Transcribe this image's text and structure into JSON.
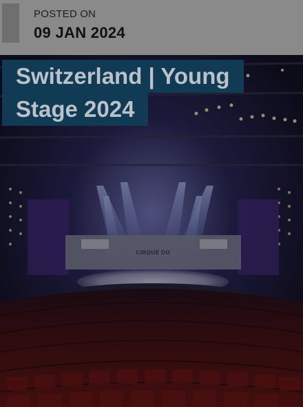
{
  "post": {
    "posted_label": "POSTED ON",
    "posted_date": "09 JAN 2024",
    "title_line_1": "Switzerland | Young",
    "title_line_2": "Stage 2024"
  },
  "hero": {
    "screen_text": "CIRQUE DU"
  },
  "colors": {
    "overlay": "#7f7f7f",
    "title_bg": "#113a54",
    "title_text": "#b9c2c8",
    "seats": "#5a1414",
    "stage_light": "#6c6fb5"
  }
}
